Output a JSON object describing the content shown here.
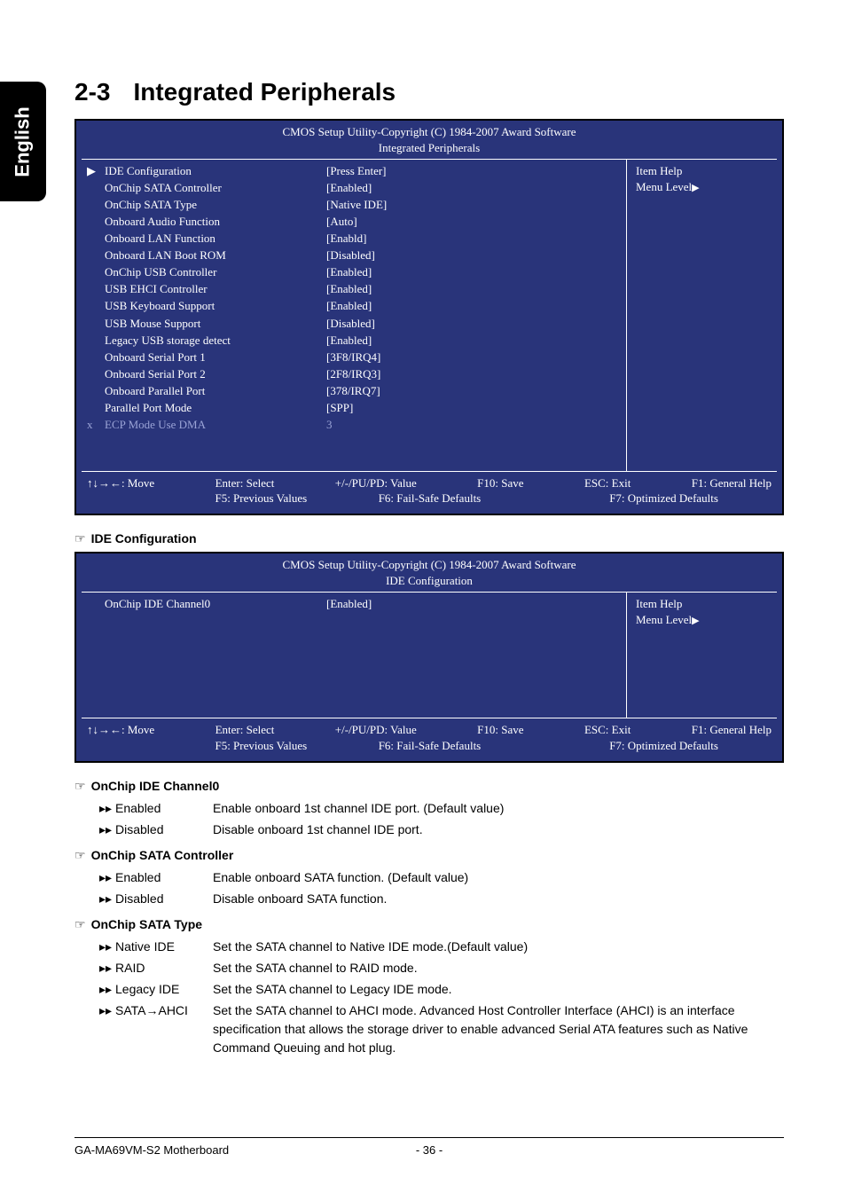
{
  "sidebar": {
    "label": "English"
  },
  "title": {
    "num": "2-3",
    "text": "Integrated Peripherals"
  },
  "bios1": {
    "header1": "CMOS Setup Utility-Copyright (C) 1984-2007 Award Software",
    "header2": "Integrated Peripherals",
    "rows": [
      {
        "marker": "▶",
        "label": "IDE Configuration",
        "value": "[Press Enter]"
      },
      {
        "marker": "",
        "label": "OnChip SATA Controller",
        "value": "[Enabled]"
      },
      {
        "marker": "",
        "label": "OnChip SATA Type",
        "value": "[Native IDE]"
      },
      {
        "marker": "",
        "label": "Onboard Audio Function",
        "value": "[Auto]"
      },
      {
        "marker": "",
        "label": "Onboard LAN Function",
        "value": "[Enabld]"
      },
      {
        "marker": "",
        "label": "Onboard LAN Boot ROM",
        "value": "[Disabled]"
      },
      {
        "marker": "",
        "label": "OnChip USB Controller",
        "value": "[Enabled]"
      },
      {
        "marker": "",
        "label": "USB EHCI Controller",
        "value": "[Enabled]"
      },
      {
        "marker": "",
        "label": "USB Keyboard Support",
        "value": "[Enabled]"
      },
      {
        "marker": "",
        "label": "USB Mouse Support",
        "value": "[Disabled]"
      },
      {
        "marker": "",
        "label": "Legacy USB storage detect",
        "value": "[Enabled]"
      },
      {
        "marker": "",
        "label": "Onboard Serial Port 1",
        "value": "[3F8/IRQ4]"
      },
      {
        "marker": "",
        "label": "Onboard Serial Port 2",
        "value": "[2F8/IRQ3]"
      },
      {
        "marker": "",
        "label": "Onboard Parallel Port",
        "value": "[378/IRQ7]"
      },
      {
        "marker": "",
        "label": "Parallel Port Mode",
        "value": "[SPP]"
      },
      {
        "marker": "x",
        "label": "ECP Mode Use DMA",
        "value": "3",
        "dim": true
      }
    ],
    "side": {
      "title": "Item Help",
      "menu": "Menu Level",
      "tri": "▶"
    },
    "footer": {
      "move": "↑↓→←: Move",
      "enter": "Enter: Select",
      "pupd": "+/-/PU/PD: Value",
      "f10": "F10: Save",
      "esc": "ESC: Exit",
      "f1": "F1: General Help",
      "f5": "F5: Previous Values",
      "f6": "F6: Fail-Safe Defaults",
      "f7": "F7: Optimized Defaults"
    }
  },
  "heading_ide": "IDE Configuration",
  "bios2": {
    "header1": "CMOS Setup Utility-Copyright (C) 1984-2007 Award Software",
    "header2": "IDE Configuration",
    "rows": [
      {
        "marker": "",
        "label": "OnChip IDE Channel0",
        "value": "[Enabled]"
      }
    ],
    "side": {
      "title": "Item Help",
      "menu": "Menu Level",
      "tri": "▶"
    },
    "footer": {
      "move": "↑↓→←: Move",
      "enter": "Enter: Select",
      "pupd": "+/-/PU/PD: Value",
      "f10": "F10: Save",
      "esc": "ESC: Exit",
      "f1": "F1: General Help",
      "f5": "F5: Previous Values",
      "f6": "F6: Fail-Safe Defaults",
      "f7": "F7: Optimized Defaults"
    }
  },
  "options": [
    {
      "heading": "OnChip IDE Channel0",
      "items": [
        {
          "name": "Enabled",
          "desc": "Enable onboard 1st channel IDE port. (Default value)"
        },
        {
          "name": "Disabled",
          "desc": "Disable onboard 1st channel IDE port."
        }
      ]
    },
    {
      "heading": "OnChip SATA Controller",
      "items": [
        {
          "name": "Enabled",
          "desc": "Enable onboard SATA function. (Default value)"
        },
        {
          "name": "Disabled",
          "desc": "Disable onboard SATA function."
        }
      ]
    },
    {
      "heading": "OnChip SATA Type",
      "items": [
        {
          "name": "Native IDE",
          "desc": "Set the SATA channel to Native IDE mode.(Default value)"
        },
        {
          "name": "RAID",
          "desc": "Set the SATA channel to RAID mode."
        },
        {
          "name": "Legacy IDE",
          "desc": "Set the SATA channel to Legacy IDE mode."
        },
        {
          "name": "SATA→AHCI",
          "desc": "Set the SATA channel to AHCI mode. Advanced Host Controller Interface (AHCI) is an interface specification that allows the storage driver to enable advanced Serial ATA features such as Native Command Queuing and hot plug."
        }
      ]
    }
  ],
  "footer": {
    "left": "GA-MA69VM-S2 Motherboard",
    "page": "- 36 -"
  },
  "arrow_glyph": "▸▸"
}
